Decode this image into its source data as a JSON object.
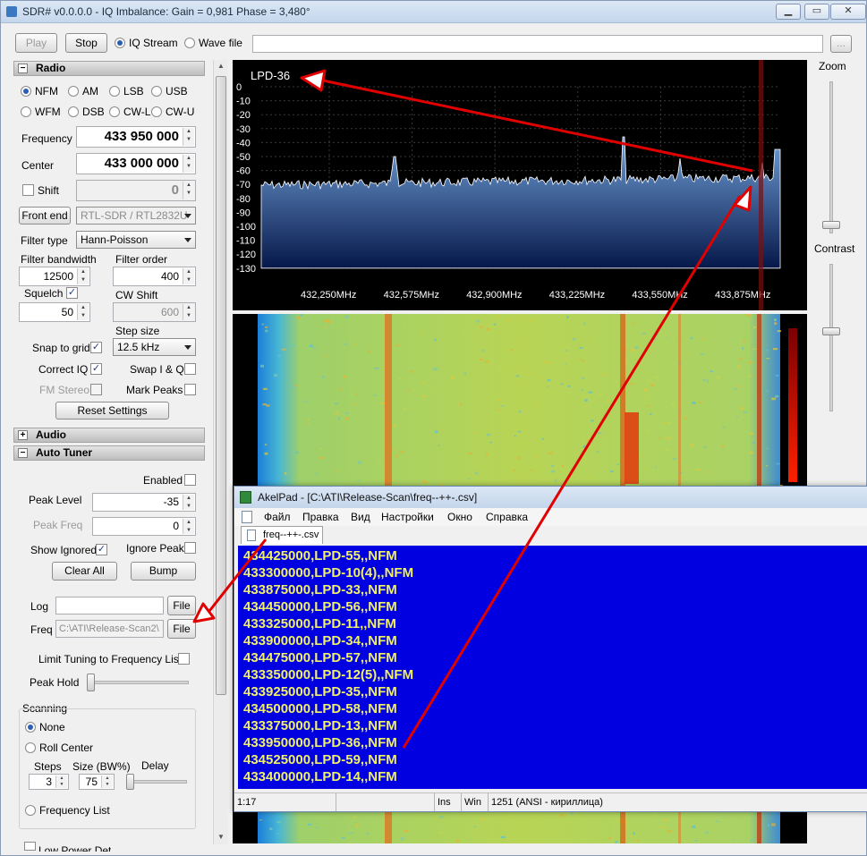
{
  "window": {
    "title": "SDR# v0.0.0.0 - IQ Imbalance: Gain = 0,981 Phase = 3,480°"
  },
  "toolbar": {
    "play": "Play",
    "stop": "Stop",
    "iq_stream": "IQ Stream",
    "wave_file": "Wave file",
    "browse": "..."
  },
  "radio": {
    "header": "Radio",
    "modes": [
      "NFM",
      "AM",
      "LSB",
      "USB",
      "WFM",
      "DSB",
      "CW-L",
      "CW-U"
    ],
    "selected_mode": "NFM",
    "frequency_label": "Frequency",
    "frequency": "433 950 000",
    "center_label": "Center",
    "center": "433 000 000",
    "shift_label": "Shift",
    "shift": "0",
    "front_end_label": "Front end",
    "front_end": "RTL-SDR / RTL2832U",
    "filter_type_label": "Filter type",
    "filter_type": "Hann-Poisson",
    "filter_bandwidth_label": "Filter bandwidth",
    "filter_bandwidth": "12500",
    "filter_order_label": "Filter order",
    "filter_order": "400",
    "squelch_label": "Squelch",
    "squelch": "50",
    "cw_shift_label": "CW Shift",
    "cw_shift": "600",
    "step_size_label": "Step size",
    "step_size": "12.5 kHz",
    "snap_to_grid": "Snap to grid",
    "correct_iq": "Correct IQ",
    "swap_iq": "Swap I & Q",
    "fm_stereo": "FM Stereo",
    "mark_peaks": "Mark Peaks",
    "reset_settings": "Reset Settings"
  },
  "audio": {
    "header": "Audio"
  },
  "auto_tuner": {
    "header": "Auto Tuner",
    "enabled": "Enabled",
    "peak_level_label": "Peak Level",
    "peak_level": "-35",
    "peak_freq_label": "Peak Freq",
    "peak_freq": "0",
    "show_ignored": "Show Ignored",
    "ignore_peak": "Ignore Peak",
    "clear_all": "Clear All",
    "bump": "Bump",
    "log_label": "Log",
    "log_file_btn": "File",
    "freq_label": "Freq",
    "freq_path": "C:\\ATI\\Release-Scan2\\",
    "freq_file_btn": "File",
    "limit_tuning": "Limit Tuning to Frequency List",
    "peak_hold": "Peak Hold"
  },
  "scanning": {
    "header": "Scanning",
    "none": "None",
    "roll_center": "Roll Center",
    "steps_label": "Steps",
    "steps": "3",
    "size_label": "Size (BW%)",
    "size": "75",
    "delay_label": "Delay",
    "frequency_list": "Frequency List",
    "cut_label": "Low Power Det"
  },
  "spectrum": {
    "marker_label": "LPD-36",
    "y_ticks": [
      "0",
      "-10",
      "-20",
      "-30",
      "-40",
      "-50",
      "-60",
      "-70",
      "-80",
      "-90",
      "-100",
      "-110",
      "-120",
      "-130"
    ],
    "x_ticks": [
      "432,250MHz",
      "432,575MHz",
      "432,900MHz",
      "433,225MHz",
      "433,550MHz",
      "433,875MHz"
    ]
  },
  "right_panel": {
    "zoom": "Zoom",
    "contrast": "Contrast"
  },
  "akelpad": {
    "title": "AkelPad - [C:\\ATI\\Release-Scan\\freq--++-.csv]",
    "menu": [
      "Файл",
      "Правка",
      "Вид",
      "Настройки",
      "Окно",
      "Справка"
    ],
    "tab": "freq--++-.csv",
    "lines": [
      "434425000,LPD-55,,NFM",
      "433300000,LPD-10(4),,NFM",
      "433875000,LPD-33,,NFM",
      "434450000,LPD-56,,NFM",
      "433325000,LPD-11,,NFM",
      "433900000,LPD-34,,NFM",
      "434475000,LPD-57,,NFM",
      "433350000,LPD-12(5),,NFM",
      "433925000,LPD-35,,NFM",
      "434500000,LPD-58,,NFM",
      "433375000,LPD-13,,NFM",
      "433950000,LPD-36,,NFM",
      "434525000,LPD-59,,NFM",
      "433400000,LPD-14,,NFM"
    ],
    "status": {
      "pos": "1:17",
      "ins": "Ins",
      "win": "Win",
      "encoding": "1251  (ANSI - кириллица)"
    }
  },
  "colors": {
    "accent": "#2c5db5",
    "editor_bg": "#0000e0",
    "editor_text": "#f0f06a",
    "annotation": "#e00000"
  }
}
